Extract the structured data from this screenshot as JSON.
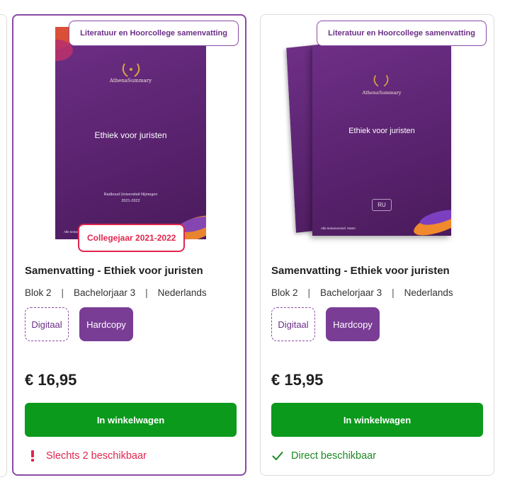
{
  "products": [
    {
      "badge": "Literatuur en Hoorcollege samenvatting",
      "cover": {
        "brand": "AthenaSummary",
        "title": "Ethiek voor juristen",
        "university": "Radboud Universiteit Nijmegen",
        "year": "2021-2022",
        "footer": "Alle tentamenstof. Niets."
      },
      "year_badge": "Collegejaar 2021-2022",
      "title": "Samenvatting - Ethiek voor juristen",
      "meta": [
        "Blok 2",
        "Bachelorjaar 3",
        "Nederlands"
      ],
      "meta_separator": "|",
      "options": [
        "Digitaal",
        "Hardcopy"
      ],
      "price": "€ 16,95",
      "cart_button": "In winkelwagen",
      "stock_icon": "exclamation-icon",
      "stock_text": "Slechts 2 beschikbaar",
      "stock_color": "#e0264f"
    },
    {
      "badge": "Literatuur en Hoorcollege samenvatting",
      "cover": {
        "brand": "AthenaSummary",
        "title": "Ethiek voor juristen",
        "university_code": "RU",
        "footer": "Alle tentamenstof. Niets!"
      },
      "title": "Samenvatting - Ethiek voor juristen",
      "meta": [
        "Blok 2",
        "Bachelorjaar 3",
        "Nederlands"
      ],
      "meta_separator": "|",
      "options": [
        "Digitaal",
        "Hardcopy"
      ],
      "price": "€ 15,95",
      "cart_button": "In winkelwagen",
      "stock_icon": "checkmark-icon",
      "stock_text": "Direct beschikbaar",
      "stock_color": "#1b8a23"
    }
  ],
  "colors": {
    "brand_purple": "#7a3d96",
    "cart_green": "#0b9a1c",
    "alert_red": "#e0264f"
  }
}
